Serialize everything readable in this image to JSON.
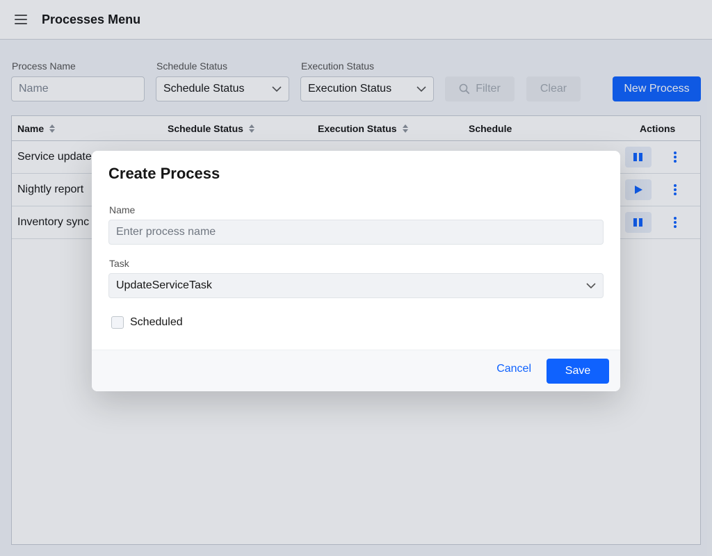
{
  "header": {
    "title": "Processes Menu",
    "menu_icon": "hamburger-icon"
  },
  "filters": {
    "process_name": {
      "label": "Process Name",
      "placeholder": "Name"
    },
    "schedule_status": {
      "label": "Schedule Status",
      "value": "Schedule Status"
    },
    "execution_status": {
      "label": "Execution Status",
      "value": "Execution Status"
    },
    "filter_button": "Filter",
    "clear_button": "Clear",
    "new_process_button": "New Process"
  },
  "table": {
    "columns": [
      "Name",
      "Schedule Status",
      "Execution Status",
      "Schedule",
      "Actions"
    ],
    "rows": [
      {
        "name": "Service update",
        "action_icon": "pause-icon"
      },
      {
        "name": "Nightly report",
        "action_icon": "play-icon"
      },
      {
        "name": "Inventory sync",
        "action_icon": "pause-icon"
      }
    ]
  },
  "modal": {
    "title": "Create Process",
    "name_label": "Name",
    "name_placeholder": "Enter process name",
    "task_label": "Task",
    "task_value": "UpdateServiceTask",
    "scheduled_label": "Scheduled",
    "scheduled_checked": false,
    "cancel_button": "Cancel",
    "save_button": "Save"
  },
  "colors": {
    "primary": "#0f62fe",
    "overlay": "rgba(22,38,66,0.14)"
  }
}
